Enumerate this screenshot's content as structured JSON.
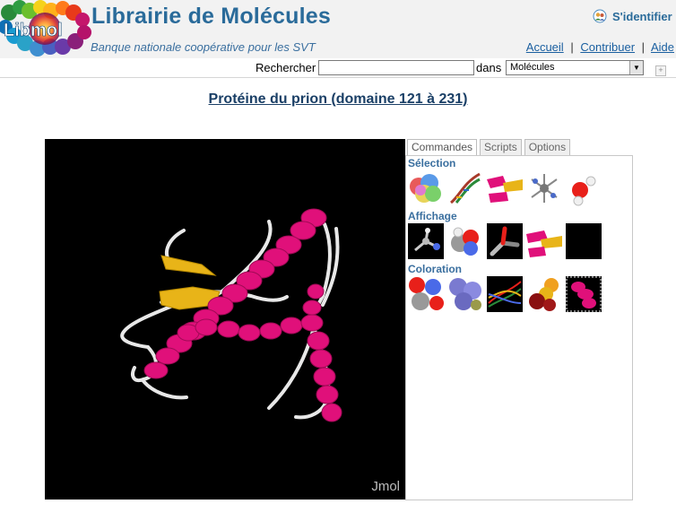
{
  "header": {
    "logo_text": "Libmol",
    "title": "Librairie de Molécules",
    "subtitle": "Banque nationale coopérative pour les SVT",
    "login_label": "S'identifier",
    "nav": {
      "home": "Accueil",
      "contribute": "Contribuer",
      "help": "Aide"
    }
  },
  "search": {
    "label": "Rechercher",
    "query": "",
    "in_label": "dans",
    "scope_selected": "Molécules"
  },
  "page": {
    "title": "Protéine du prion (domaine 121 à 231)"
  },
  "viewer": {
    "label": "Jmol",
    "background": "#000000"
  },
  "tabs": [
    "Commandes",
    "Scripts",
    "Options"
  ],
  "panel": {
    "selection_title": "Sélection",
    "display_title": "Affichage",
    "coloring_title": "Coloration"
  },
  "colors": {
    "brand": "#2a6b9a",
    "helix": "#e0107a",
    "sheet": "#e6b318",
    "coil": "#e6e6e6"
  }
}
